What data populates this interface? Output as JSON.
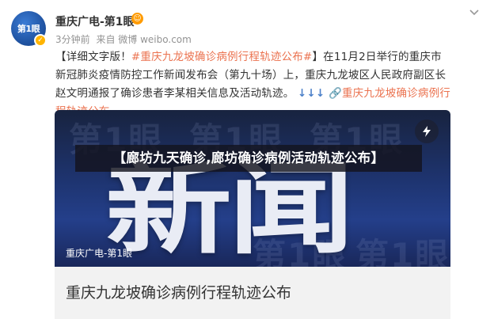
{
  "post": {
    "avatar_label": "第1眼",
    "author": "重庆广电-第1眼",
    "meta": {
      "time": "3分钟前",
      "source": "来自 微博 weibo.com"
    },
    "text": {
      "prefix": "【详细文字版！",
      "hashtag": "#重庆九龙坡确诊病例行程轨迹公布#",
      "body": "】在11月2日举行的重庆市新冠肺炎疫情防控工作新闻发布会（第九十场）上，重庆九龙坡区人民政府副区长赵文明通报了确诊患者李某相关信息及活动轨迹。",
      "arrows": "↓↓↓",
      "link_label": "重庆九龙坡确诊病例行程轨迹公布"
    },
    "card": {
      "headline": "【廊坊九天确诊,廊坊确诊病例活动轨迹公布】",
      "big_text": "新闻",
      "bg_logo": "第1眼",
      "source_label": "重庆广电-第1眼",
      "title": "重庆九龙坡确诊病例行程轨迹公布"
    }
  },
  "icons": {
    "verified": "verified-badge-icon",
    "member": "smile-icon",
    "menu": "chevron-down-icon",
    "flash": "lightning-icon",
    "link": "link-icon"
  },
  "colors": {
    "link": "#eb7350",
    "muted": "#939393",
    "verified": "#ffb400",
    "card_bg": "#1e3470"
  }
}
